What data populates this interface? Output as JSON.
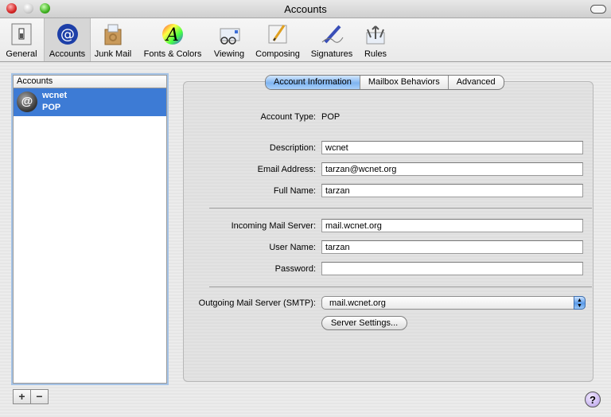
{
  "window": {
    "title": "Accounts"
  },
  "toolbar": {
    "items": [
      {
        "label": "General",
        "icon": "switch-icon"
      },
      {
        "label": "Accounts",
        "icon": "at-sign-icon",
        "selected": true
      },
      {
        "label": "Junk Mail",
        "icon": "junk-mail-icon"
      },
      {
        "label": "Fonts & Colors",
        "icon": "fonts-colors-icon"
      },
      {
        "label": "Viewing",
        "icon": "glasses-icon"
      },
      {
        "label": "Composing",
        "icon": "pencil-icon"
      },
      {
        "label": "Signatures",
        "icon": "pen-icon"
      },
      {
        "label": "Rules",
        "icon": "rules-icon"
      }
    ]
  },
  "accounts_list": {
    "header": "Accounts",
    "items": [
      {
        "name": "wcnet",
        "type": "POP",
        "selected": true
      }
    ],
    "add_label": "+",
    "remove_label": "−"
  },
  "tabs": [
    {
      "label": "Account Information",
      "active": true
    },
    {
      "label": "Mailbox Behaviors"
    },
    {
      "label": "Advanced"
    }
  ],
  "form": {
    "account_type_label": "Account Type:",
    "account_type_value": "POP",
    "description_label": "Description:",
    "description_value": "wcnet",
    "email_label": "Email Address:",
    "email_value": "tarzan@wcnet.org",
    "fullname_label": "Full Name:",
    "fullname_value": "tarzan",
    "incoming_label": "Incoming Mail Server:",
    "incoming_value": "mail.wcnet.org",
    "username_label": "User Name:",
    "username_value": "tarzan",
    "password_label": "Password:",
    "password_value": "",
    "smtp_label": "Outgoing Mail Server (SMTP):",
    "smtp_value": "mail.wcnet.org",
    "server_settings_label": "Server Settings..."
  },
  "help": {
    "label": "?"
  }
}
